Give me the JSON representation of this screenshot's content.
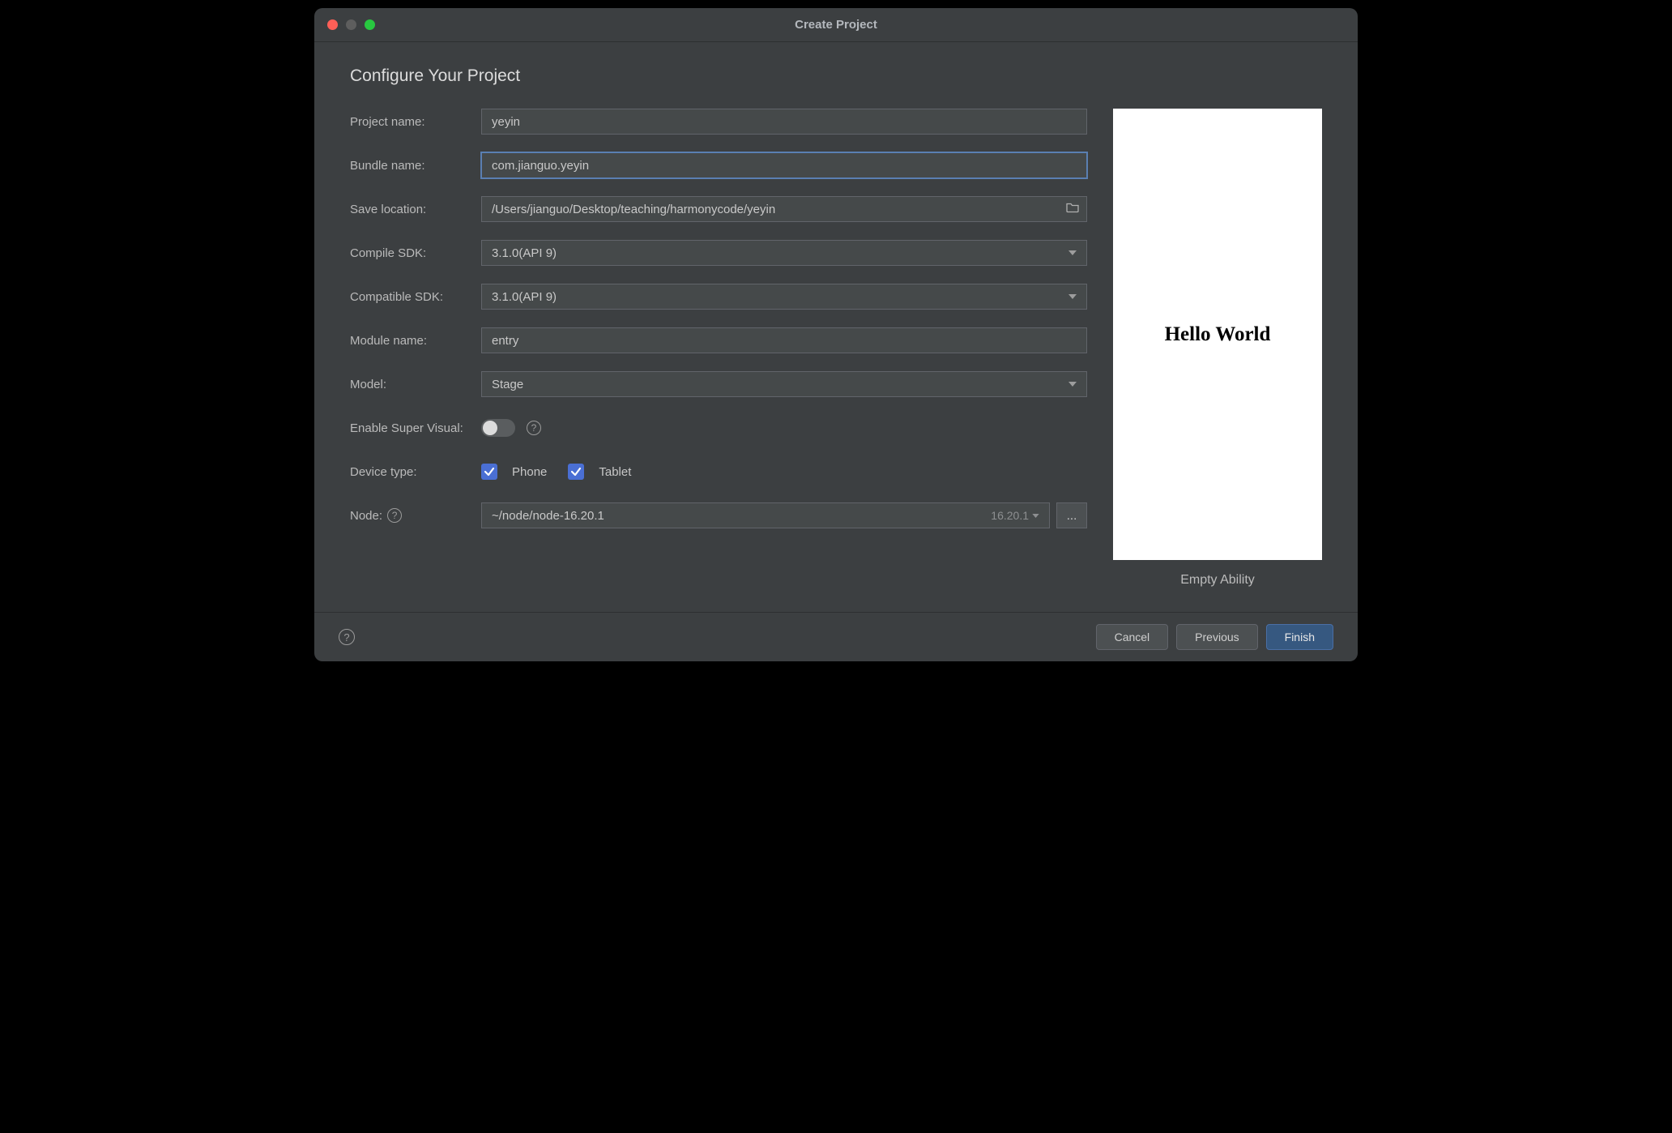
{
  "window": {
    "title": "Create Project"
  },
  "page": {
    "heading": "Configure Your Project"
  },
  "form": {
    "projectName": {
      "label": "Project name:",
      "value": "yeyin"
    },
    "bundleName": {
      "label": "Bundle name:",
      "value": "com.jianguo.yeyin"
    },
    "saveLocation": {
      "label": "Save location:",
      "value": "/Users/jianguo/Desktop/teaching/harmonycode/yeyin"
    },
    "compileSdk": {
      "label": "Compile SDK:",
      "value": "3.1.0(API 9)"
    },
    "compatibleSdk": {
      "label": "Compatible SDK:",
      "value": "3.1.0(API 9)"
    },
    "moduleName": {
      "label": "Module name:",
      "value": "entry"
    },
    "model": {
      "label": "Model:",
      "value": "Stage"
    },
    "enableSuperVisual": {
      "label": "Enable Super Visual:",
      "value": false
    },
    "deviceType": {
      "label": "Device type:",
      "options": [
        {
          "name": "Phone",
          "checked": true
        },
        {
          "name": "Tablet",
          "checked": true
        }
      ]
    },
    "node": {
      "label": "Node:",
      "path": "~/node/node-16.20.1",
      "version": "16.20.1",
      "browse": "..."
    }
  },
  "preview": {
    "content": "Hello World",
    "caption": "Empty Ability"
  },
  "footer": {
    "cancel": "Cancel",
    "previous": "Previous",
    "finish": "Finish"
  }
}
